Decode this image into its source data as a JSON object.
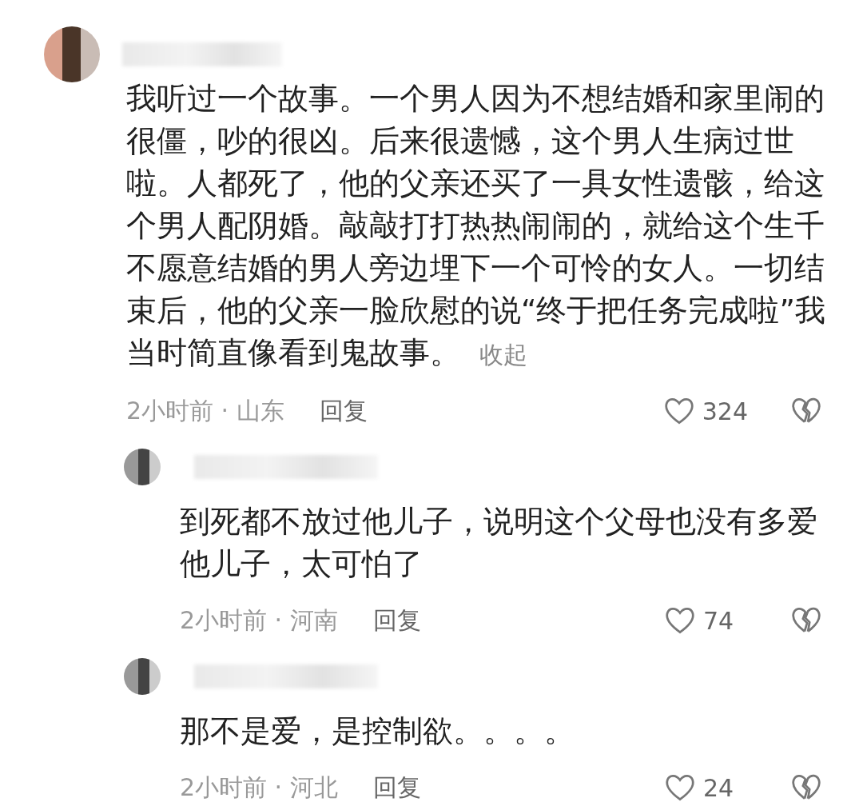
{
  "comments": [
    {
      "kind": "main",
      "text": "我听过一个故事。一个男人因为不想结婚和家里闹的很僵，吵的很凶。后来很遗憾，这个男人生病过世啦。人都死了，他的父亲还买了一具女性遗骸，给这个男人配阴婚。敲敲打打热热闹闹的，就给这个生千不愿意结婚的男人旁边埋下一个可怜的女人。一切结束后，他的父亲一脸欣慰的说“终于把任务完成啦”我当时简直像看到鬼故事。",
      "collapse": "收起",
      "meta": "2小时前 · 山东",
      "reply": "回复",
      "likes": "324"
    },
    {
      "kind": "reply",
      "text": "到死都不放过他儿子，说明这个父母也没有多爱他儿子，太可怕了",
      "meta": "2小时前 · 河南",
      "reply": "回复",
      "likes": "74"
    },
    {
      "kind": "reply",
      "text": "那不是爱，是控制欲。。。。",
      "meta": "2小时前 · 河北",
      "reply": "回复",
      "likes": "24"
    }
  ]
}
